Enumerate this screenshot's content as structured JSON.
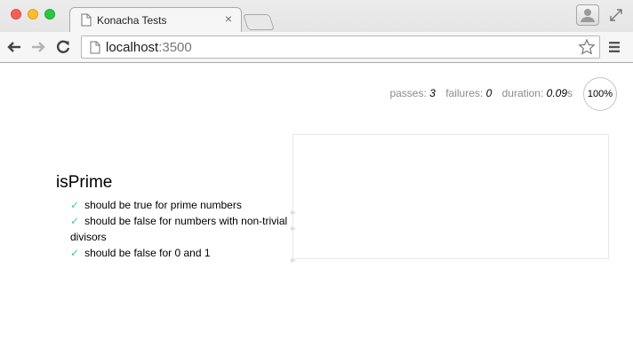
{
  "browser": {
    "tab": {
      "title": "Konacha Tests",
      "close": "×"
    },
    "address": {
      "host": "localhost",
      "port": ":3500"
    }
  },
  "stats": {
    "passes_label": "passes:",
    "passes": "3",
    "failures_label": "failures:",
    "failures": "0",
    "duration_label": "duration:",
    "duration": "0.09",
    "duration_unit": "s",
    "progress": "100%"
  },
  "suite": {
    "title": "isPrime",
    "check": "✓",
    "specs": [
      {
        "label": "should be true for prime numbers"
      },
      {
        "label": "should be false for numbers with non-trivial divisors"
      },
      {
        "label": "should be false for 0 and 1"
      }
    ]
  },
  "colors": {
    "pass_check": "#4ac4a7",
    "traffic_close": "#fc5f57",
    "traffic_minimize": "#fdbd2e",
    "traffic_maximize": "#28c840"
  }
}
